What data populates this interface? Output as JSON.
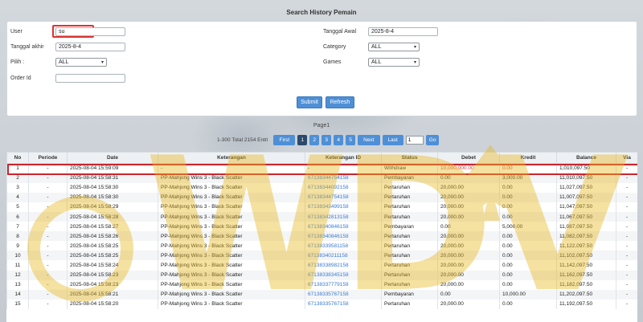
{
  "title": "Search History Pemain",
  "form": {
    "user_label": "User",
    "user_value": "su",
    "tanggal_awal_label": "Tanggal Awal",
    "tanggal_awal_value": "2025-8-4",
    "tanggal_akhir_label": "Tanggal akhir",
    "tanggal_akhir_value": "2025-8-4",
    "category_label": "Category",
    "category_value": "ALL",
    "pilih_label": "Pilih  :",
    "pilih_value": "ALL",
    "games_label": "Games",
    "games_value": "ALL",
    "order_label": "Order Id",
    "order_value": "",
    "submit_label": "Submit",
    "refresh_label": "Refresh"
  },
  "pager": {
    "title": "Page1",
    "info": "1-300 Total 2154 Entri",
    "first": "First",
    "pages": [
      "1",
      "2",
      "3",
      "4",
      "5"
    ],
    "next": "Next",
    "last": "Last",
    "goto_value": "1",
    "go": "Go"
  },
  "table": {
    "headers": [
      "No",
      "Periode",
      "Date",
      "Keterangan",
      "Keterangan ID",
      "Status",
      "Debet",
      "Kredit",
      "Balance",
      "Via"
    ],
    "rows": [
      [
        "1",
        "-",
        "2025-08-04 15:59:09",
        "-",
        "-",
        "Withdraw",
        "10,000,000.00",
        "0.00",
        "1,010,097.50",
        "-"
      ],
      [
        "2",
        "-",
        "2025-08-04 15:58:31",
        "PP-Mahjong Wins 3 - Black Scatter",
        "67138344754158",
        "Pembayaran",
        "0.00",
        "3,000.00",
        "11,010,097.50",
        "-"
      ],
      [
        "3",
        "-",
        "2025-08-04 15:58:30",
        "PP-Mahjong Wins 3 - Black Scatter",
        "67138344092158",
        "Pertaruhan",
        "20,000.00",
        "0.00",
        "11,027,097.50",
        "-"
      ],
      [
        "4",
        "-",
        "2025-08-04 15:58:30",
        "PP-Mahjong Wins 3 - Black Scatter",
        "67138344754158",
        "Pertaruhan",
        "20,000.00",
        "0.00",
        "11,007,097.50",
        "-"
      ],
      [
        "5",
        "-",
        "2025-08-04 15:58:29",
        "PP-Mahjong Wins 3 - Black Scatter",
        "67138343499158",
        "Pertaruhan",
        "20,000.00",
        "0.00",
        "11,047,097.50",
        "-"
      ],
      [
        "6",
        "-",
        "2025-08-04 15:58:28",
        "PP-Mahjong Wins 3 - Black Scatter",
        "67138342813158",
        "Pertaruhan",
        "20,000.00",
        "0.00",
        "11,067,097.50",
        "-"
      ],
      [
        "7",
        "-",
        "2025-08-04 15:58:27",
        "PP-Mahjong Wins 3 - Black Scatter",
        "67138340846158",
        "Pembayaran",
        "0.00",
        "5,000.00",
        "11,087,097.50",
        "-"
      ],
      [
        "8",
        "-",
        "2025-08-04 15:58:26",
        "PP-Mahjong Wins 3 - Black Scatter",
        "67138340846158",
        "Pertaruhan",
        "20,000.00",
        "0.00",
        "11,082,097.50",
        "-"
      ],
      [
        "9",
        "-",
        "2025-08-04 15:58:25",
        "PP-Mahjong Wins 3 - Black Scatter",
        "67138339581158",
        "Pertaruhan",
        "20,000.00",
        "0.00",
        "11,122,097.50",
        "-"
      ],
      [
        "10",
        "-",
        "2025-08-04 15:58:25",
        "PP-Mahjong Wins 3 - Black Scatter",
        "67138340211158",
        "Pertaruhan",
        "20,000.00",
        "0.00",
        "11,102,097.50",
        "-"
      ],
      [
        "11",
        "-",
        "2025-08-04 15:58:24",
        "PP-Mahjong Wins 3 - Black Scatter",
        "67138338982158",
        "Pertaruhan",
        "20,000.00",
        "0.00",
        "11,142,097.50",
        "-"
      ],
      [
        "12",
        "-",
        "2025-08-04 15:58:23",
        "PP-Mahjong Wins 3 - Black Scatter",
        "67138338345158",
        "Pertaruhan",
        "20,000.00",
        "0.00",
        "11,162,097.50",
        "-"
      ],
      [
        "13",
        "-",
        "2025-08-04 15:58:23",
        "PP-Mahjong Wins 3 - Black Scatter",
        "67138337779158",
        "Pertaruhan",
        "20,000.00",
        "0.00",
        "11,182,097.50",
        "-"
      ],
      [
        "14",
        "-",
        "2025-08-04 15:58:21",
        "PP-Mahjong Wins 3 - Black Scatter",
        "67138335767158",
        "Pembayaran",
        "0.00",
        "10,000.00",
        "11,202,097.50",
        "-"
      ],
      [
        "15",
        "-",
        "2025-08-04 15:58:20",
        "PP-Mahjong Wins 3 - Black Scatter",
        "67138335767158",
        "Pertaruhan",
        "20,000.00",
        "0.00",
        "11,192,097.50",
        "-"
      ]
    ]
  },
  "colors": {
    "accent": "#4f8fd6",
    "highlight": "#c9262e",
    "link": "#3a7bd5",
    "watermark": "#e8b820"
  },
  "watermark_text": "WDVK"
}
